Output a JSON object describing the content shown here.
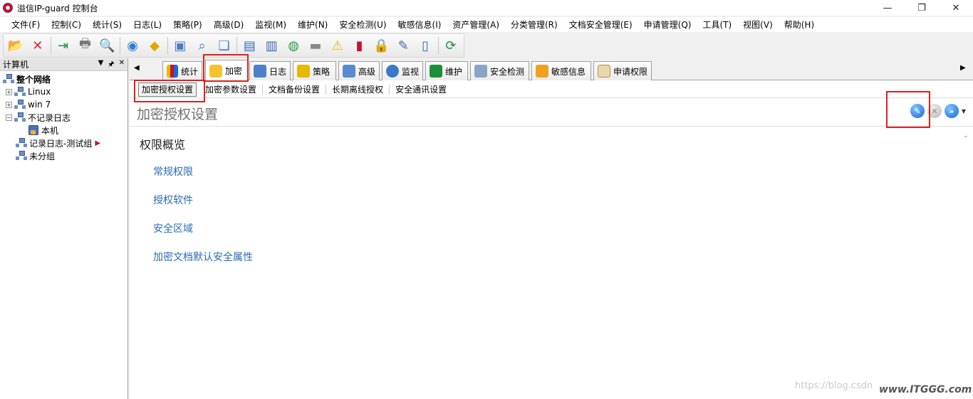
{
  "window": {
    "title": "溢信IP-guard 控制台"
  },
  "menu": [
    "文件(F)",
    "控制(C)",
    "统计(S)",
    "日志(L)",
    "策略(P)",
    "高级(D)",
    "监视(M)",
    "维护(N)",
    "安全检测(U)",
    "敏感信息(I)",
    "资产管理(A)",
    "分类管理(R)",
    "文档安全管理(E)",
    "申请管理(Q)",
    "工具(T)",
    "视图(V)",
    "帮助(H)"
  ],
  "toolbar_icons": [
    "add-icon",
    "delete-icon",
    "export-icon",
    "print-icon",
    "print-preview-icon",
    "globe-icon",
    "tag-icon",
    "copy-icon",
    "search-icon",
    "window-icon",
    "computers-icon",
    "cards-icon",
    "network-icon",
    "disk-icon",
    "warning-icon",
    "chart-icon",
    "lock-icon",
    "edit-icon",
    "mobile-icon",
    "refresh-icon"
  ],
  "left_panel": {
    "title": "计算机",
    "tree": [
      {
        "label": "整个网络",
        "bold": true
      },
      {
        "label": "Linux"
      },
      {
        "label": "win 7"
      },
      {
        "label": "不记录日志"
      },
      {
        "label": "本机"
      },
      {
        "label": "记录日志-测试组"
      },
      {
        "label": "未分组"
      }
    ]
  },
  "tabs": [
    "统计",
    "加密",
    "日志",
    "策略",
    "高级",
    "监视",
    "维护",
    "安全检测",
    "敏感信息",
    "申请权限"
  ],
  "subtabs": [
    "加密授权设置",
    "加密参数设置",
    "文档备份设置",
    "长期离线授权",
    "安全通讯设置"
  ],
  "content": {
    "section_title": "加密授权设置",
    "overview_title": "权限概览",
    "links": [
      "常规权限",
      "授权软件",
      "安全区域",
      "加密文档默认安全属性"
    ]
  },
  "watermark": {
    "blog": "https://blog.csdn",
    "site": "www.ITGGG.com"
  },
  "colors": {
    "link": "#2a6ab5",
    "highlight": "#e02020",
    "action_blue": "#1769d6"
  }
}
